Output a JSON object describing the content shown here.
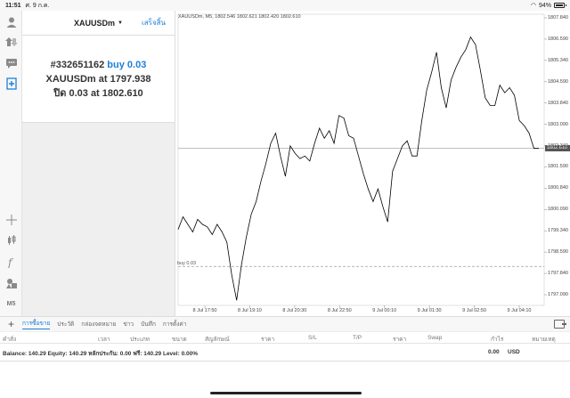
{
  "status_bar": {
    "time": "11:51",
    "date": "ศ. 9 ก.ค.",
    "battery": "94%"
  },
  "order_panel": {
    "symbol": "XAUUSDm",
    "done_label": "เสร็จสิ้น",
    "ticket": "#332651162",
    "side_text": "buy 0.03",
    "open_prefix": "XAUUSDm at",
    "open_price": "1797.938",
    "close_prefix": "ปิด 0.03 at",
    "close_price": "1802.610"
  },
  "rail": {
    "timeframe": "M5"
  },
  "chart": {
    "info": "XAUUSDm, M5, 1802.546 1802.621 1802.420 1802.610",
    "buy_label": "buy 0.03",
    "current_price": "1802.610",
    "line_color": "#000000",
    "price_line_color": "#9a9a9a"
  },
  "chart_data": {
    "type": "line",
    "title": "XAUUSDm, M5, 1802.546 1802.621 1802.420 1802.610",
    "ylim": [
      1796.4,
      1807.9
    ],
    "y_ticks": [
      "1807.840",
      "1806.590",
      "1805.340",
      "1804.590",
      "1803.840",
      "1803.090",
      "1802.340",
      "1801.590",
      "1800.840",
      "1800.090",
      "1799.340",
      "1798.590",
      "1797.840",
      "1797.090"
    ],
    "x_ticks": [
      "8 Jul 17:50",
      "8 Jul 19:10",
      "8 Jul 20:30",
      "8 Jul 22:50",
      "9 Jul 00:10",
      "9 Jul 01:30",
      "9 Jul 02:50",
      "9 Jul 04:10"
    ],
    "horizontal_lines": [
      {
        "label": "buy 0.03",
        "value": 1797.938,
        "style": "dashed"
      },
      {
        "label": "current",
        "value": 1802.61,
        "style": "solid"
      }
    ],
    "series": [
      {
        "values": [
          1799.4,
          1799.9,
          1799.6,
          1799.3,
          1799.8,
          1799.6,
          1799.5,
          1799.2,
          1799.6,
          1799.3,
          1798.9,
          1797.6,
          1796.6,
          1798.0,
          1799.1,
          1800.0,
          1800.5,
          1801.3,
          1802.0,
          1802.8,
          1803.2,
          1802.3,
          1801.5,
          1802.7,
          1802.4,
          1802.2,
          1802.3,
          1802.1,
          1802.8,
          1803.4,
          1803.0,
          1803.3,
          1802.8,
          1803.9,
          1803.8,
          1803.1,
          1803.0,
          1802.3,
          1801.6,
          1801.0,
          1800.5,
          1801.0,
          1800.3,
          1799.7,
          1801.7,
          1802.2,
          1802.7,
          1802.9,
          1802.3,
          1802.3,
          1803.7,
          1804.9,
          1805.6,
          1806.4,
          1805.0,
          1804.2,
          1805.3,
          1805.8,
          1806.2,
          1806.5,
          1807.0,
          1806.7,
          1805.7,
          1804.6,
          1804.3,
          1804.3,
          1805.1,
          1804.8,
          1805.0,
          1804.7,
          1803.7,
          1803.5,
          1803.2,
          1802.6,
          1802.6
        ]
      }
    ]
  },
  "tabs": [
    "การซื้อขาย",
    "ประวัติ",
    "กล่องจดหมาย",
    "ข่าว",
    "บันทึก",
    "การตั้งค่า"
  ],
  "columns": [
    "คำสั่ง",
    "เวลา",
    "ประเภท",
    "ขนาด",
    "สัญลักษณ์",
    "ราคา",
    "S/L",
    "T/P",
    "ราคา",
    "Swap",
    "กำไร",
    "หมายเหตุ"
  ],
  "balance": {
    "text": "Balance: 140.29 Equity: 140.29 หลักประกัน: 0.00 ฟรี: 140.29 Level: 0.00%",
    "profit": "0.00",
    "currency": "USD"
  }
}
